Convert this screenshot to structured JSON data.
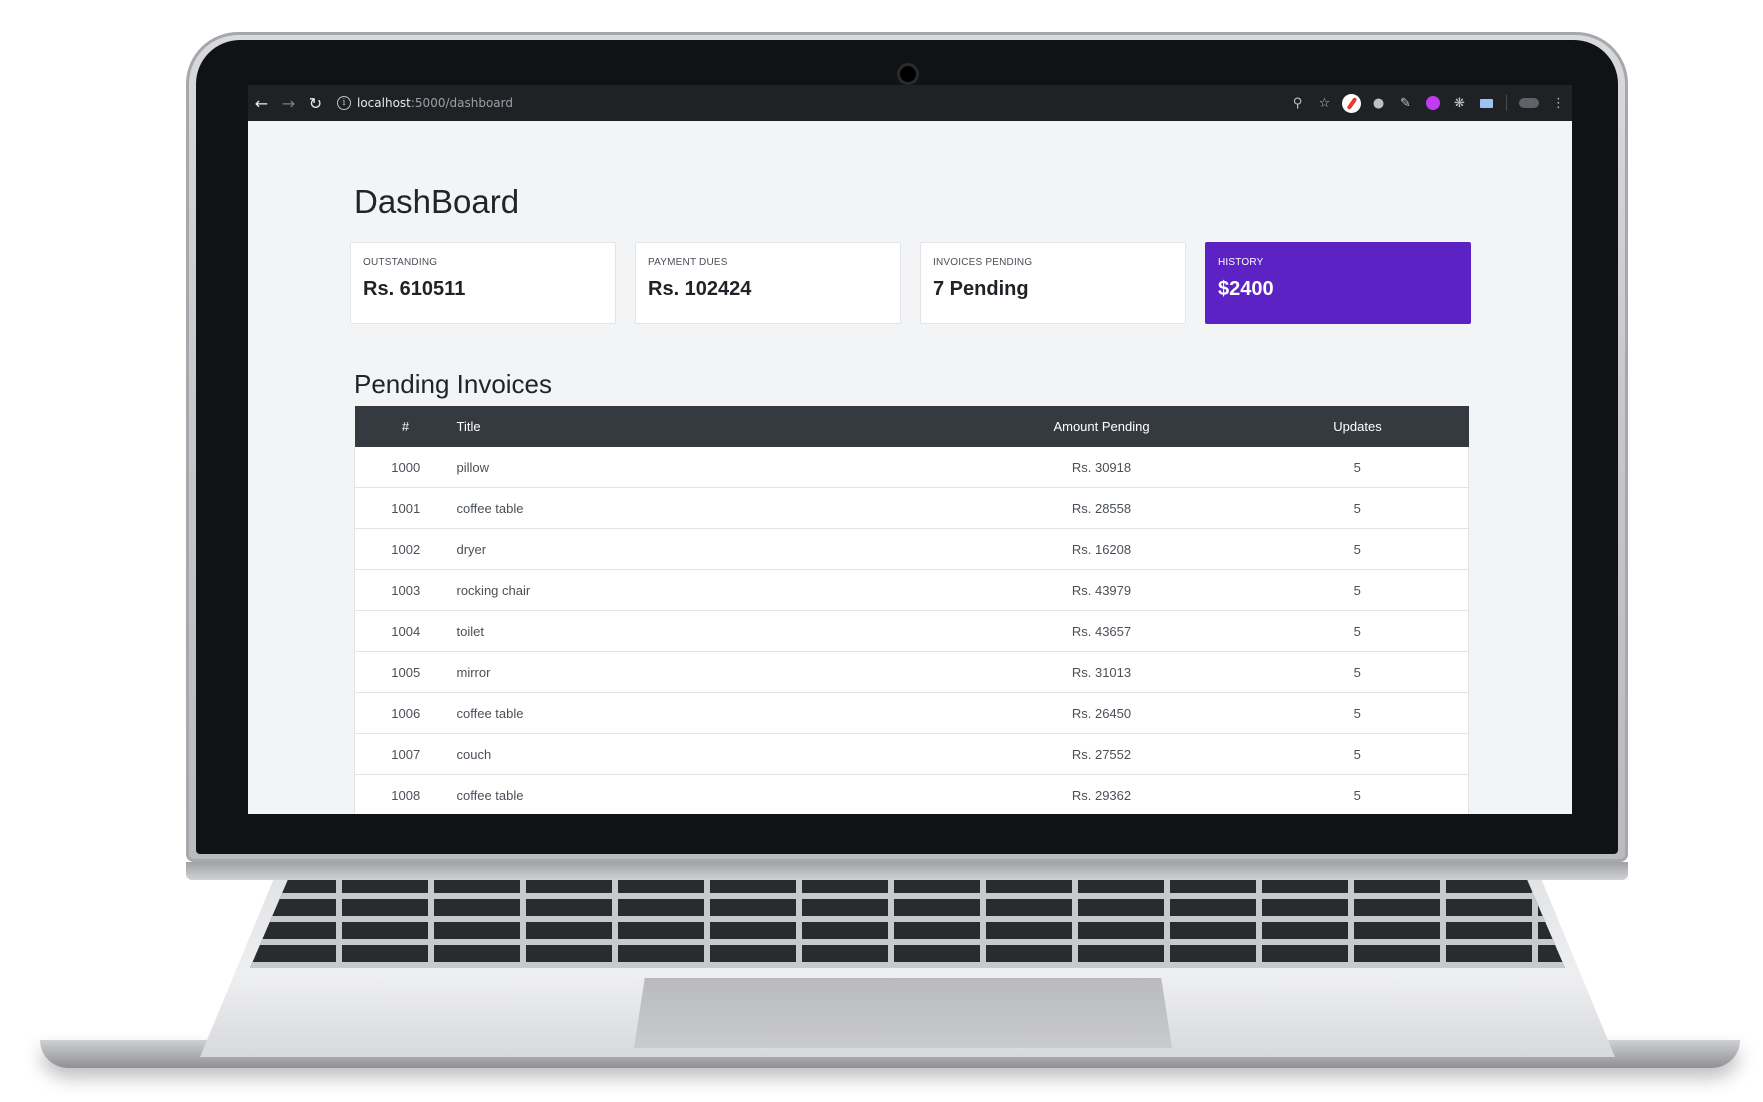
{
  "browser": {
    "url_host": "localhost",
    "url_path": ":5000/dashboard"
  },
  "page": {
    "title": "DashBoard"
  },
  "cards": [
    {
      "label": "OUTSTANDING",
      "value": "Rs. 610511"
    },
    {
      "label": "PAYMENT DUES",
      "value": "Rs. 102424"
    },
    {
      "label": "INVOICES PENDING",
      "value": "7 Pending"
    },
    {
      "label": "HISTORY",
      "value": "$2400"
    }
  ],
  "colors": {
    "accent": "#5c22c4",
    "table_header": "#343a40"
  },
  "invoices": {
    "title": "Pending Invoices",
    "columns": {
      "number": "#",
      "title": "Title",
      "amount": "Amount Pending",
      "updates": "Updates"
    },
    "rows": [
      {
        "number": "1000",
        "title": "pillow",
        "amount": "Rs. 30918",
        "updates": "5"
      },
      {
        "number": "1001",
        "title": "coffee table",
        "amount": "Rs. 28558",
        "updates": "5"
      },
      {
        "number": "1002",
        "title": "dryer",
        "amount": "Rs. 16208",
        "updates": "5"
      },
      {
        "number": "1003",
        "title": "rocking chair",
        "amount": "Rs. 43979",
        "updates": "5"
      },
      {
        "number": "1004",
        "title": "toilet",
        "amount": "Rs. 43657",
        "updates": "5"
      },
      {
        "number": "1005",
        "title": "mirror",
        "amount": "Rs. 31013",
        "updates": "5"
      },
      {
        "number": "1006",
        "title": "coffee table",
        "amount": "Rs. 26450",
        "updates": "5"
      },
      {
        "number": "1007",
        "title": "couch",
        "amount": "Rs. 27552",
        "updates": "5"
      },
      {
        "number": "1008",
        "title": "coffee table",
        "amount": "Rs. 29362",
        "updates": "5"
      }
    ]
  }
}
